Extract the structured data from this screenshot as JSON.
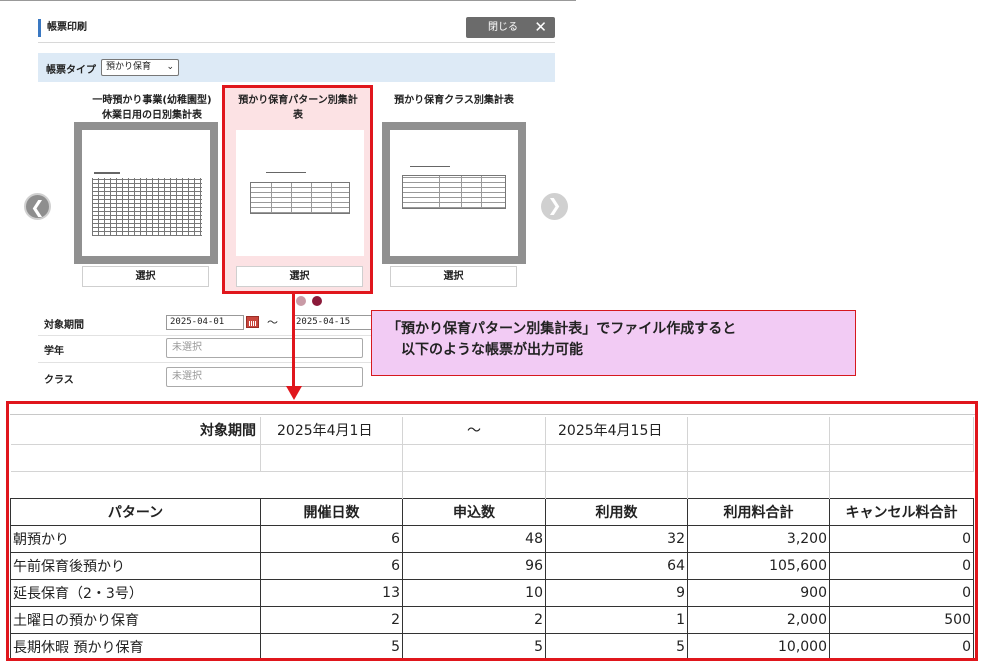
{
  "header": {
    "title": "帳票印刷",
    "close_label": "閉じる",
    "close_icon": "✕"
  },
  "type_bar": {
    "label": "帳票タイプ",
    "selected": "預かり保育"
  },
  "cards": [
    {
      "title_line1": "一時預かり事業(幼稚園型)",
      "title_line2": "休業日用の日別集計表",
      "button": "選択"
    },
    {
      "title_line1": "預かり保育パターン別集計",
      "title_line2": "表",
      "button": "選択"
    },
    {
      "title_line1": "預かり保育クラス別集計表",
      "title_line2": "",
      "button": "選択"
    }
  ],
  "carousel": {
    "prev_icon": "❮",
    "next_icon": "❯",
    "active_dot_color": "#8b1a3a",
    "inactive_dot_color": "#c99aa6"
  },
  "filters": {
    "period_label": "対象期間",
    "date_from": "2025-04-01",
    "date_sep": "～",
    "date_to": "2025-04-15",
    "grade_label": "学年",
    "grade_value": "未選択",
    "class_label": "クラス",
    "class_value": "未選択"
  },
  "callout": {
    "line1": "「預かり保育パターン別集計表」でファイル作成すると",
    "line2": "以下のような帳票が出力可能"
  },
  "report": {
    "period_label": "対象期間",
    "period_from": "2025年4月1日",
    "period_sep": "～",
    "period_to": "2025年4月15日",
    "columns": [
      "パターン",
      "開催日数",
      "申込数",
      "利用数",
      "利用料合計",
      "キャンセル料合計"
    ],
    "rows": [
      [
        "朝預かり",
        "6",
        "48",
        "32",
        "3,200",
        "0"
      ],
      [
        "午前保育後預かり",
        "6",
        "96",
        "64",
        "105,600",
        "0"
      ],
      [
        "延長保育（2・3号）",
        "13",
        "10",
        "9",
        "900",
        "0"
      ],
      [
        "土曜日の預かり保育",
        "2",
        "2",
        "1",
        "2,000",
        "500"
      ],
      [
        "長期休暇 預かり保育",
        "5",
        "5",
        "5",
        "10,000",
        "0"
      ]
    ]
  },
  "colors": {
    "highlight": "#e0161c",
    "callout_bg": "#f2cbf4",
    "typebar_bg": "#ddeaf6"
  }
}
